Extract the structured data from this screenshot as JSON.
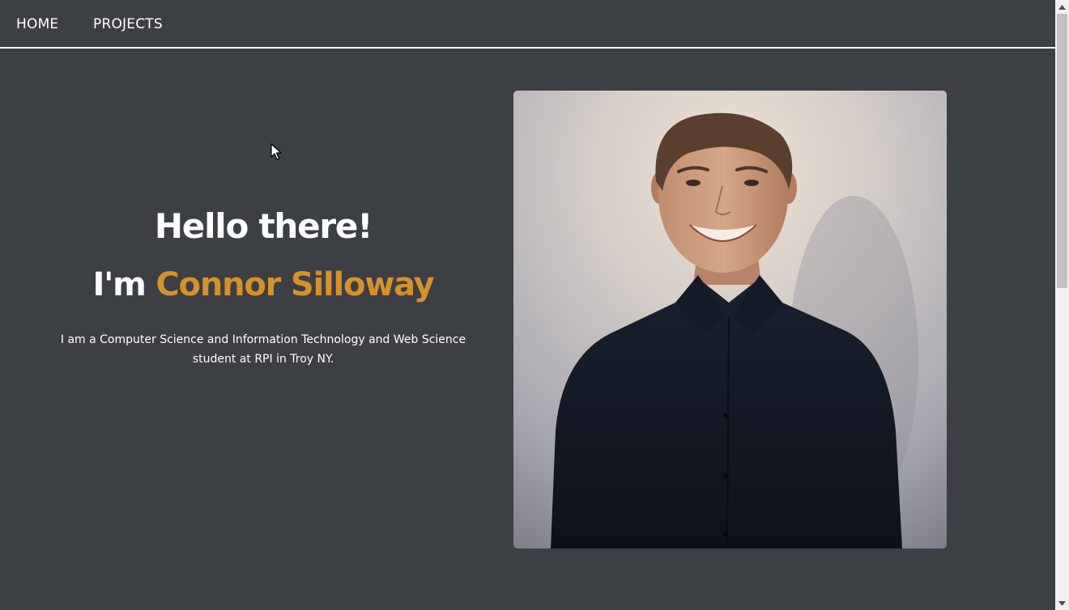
{
  "nav": {
    "home_label": "HOME",
    "projects_label": "PROJECTS"
  },
  "hero": {
    "greeting": "Hello there!",
    "intro_prefix": "I'm ",
    "name": "Connor Silloway",
    "bio": "I am a Computer Science and Information Technology and Web Science student at RPI in Troy NY."
  },
  "colors": {
    "background": "#3c3f43",
    "accent": "#d4922a",
    "text": "#ffffff"
  },
  "portrait": {
    "alt": "portrait-photo"
  },
  "icons": {
    "cursor": "mouse-pointer-icon",
    "scroll_up": "scroll-up-arrow-icon",
    "scroll_down": "scroll-down-arrow-icon"
  }
}
